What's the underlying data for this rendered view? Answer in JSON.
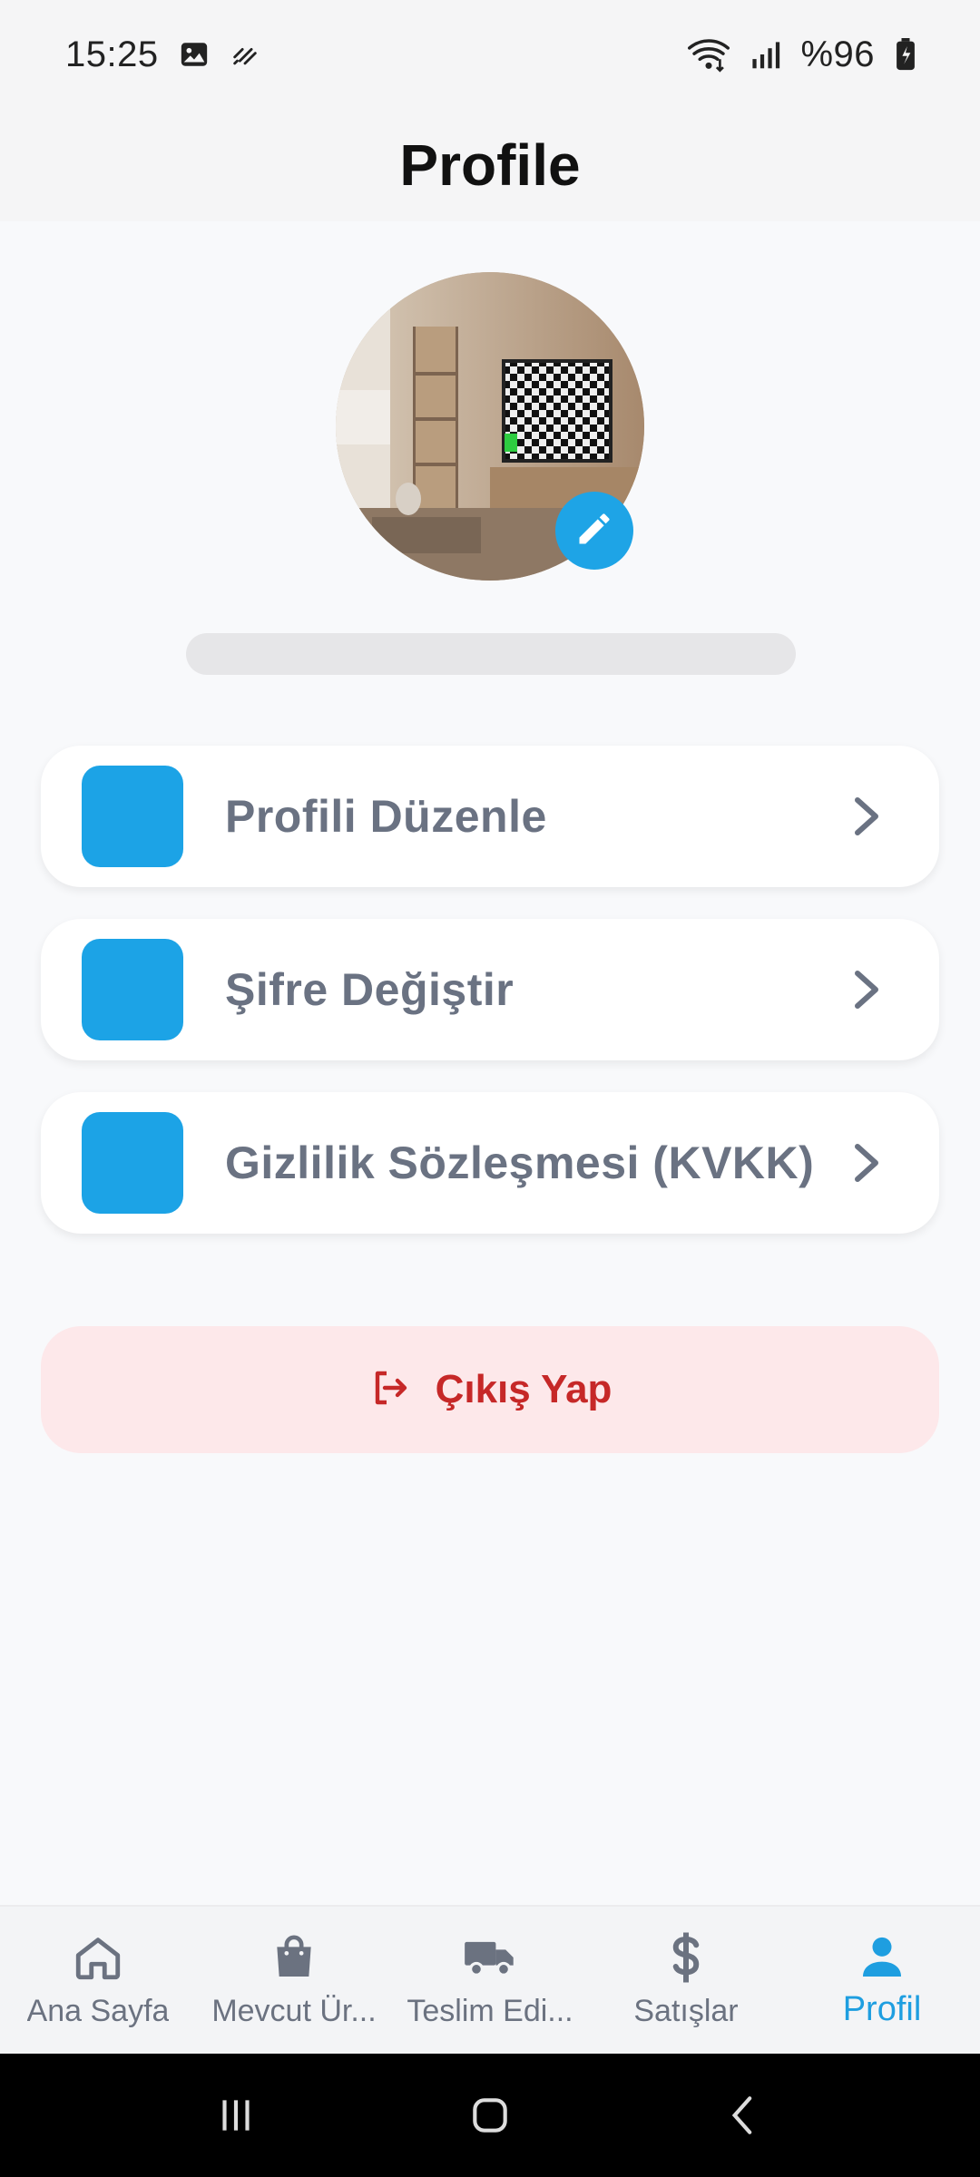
{
  "status_bar": {
    "time": "15:25",
    "battery": "%96",
    "icons": [
      "image-icon",
      "nfc-icon",
      "wifi-icon",
      "signal-icon",
      "battery-charging-icon"
    ]
  },
  "app_bar": {
    "title": "Profile"
  },
  "profile": {
    "avatar_alt": "",
    "username": ""
  },
  "menu": {
    "items": [
      {
        "label": "Profili Düzenle",
        "icon_color": "#1ca3e6"
      },
      {
        "label": "Şifre Değiştir",
        "icon_color": "#1ca3e6"
      },
      {
        "label": "Gizlilik Sözleşmesi (KVKK)",
        "icon_color": "#1ca3e6"
      }
    ]
  },
  "logout": {
    "label": "Çıkış Yap",
    "color": "#c62828",
    "background": "#fde8ea"
  },
  "bottom_nav": {
    "items": [
      {
        "label": "Ana Sayfa",
        "icon": "home-icon"
      },
      {
        "label": "Mevcut Ür...",
        "icon": "shopping-bag-icon"
      },
      {
        "label": "Teslim Edi...",
        "icon": "truck-icon"
      },
      {
        "label": "Satışlar",
        "icon": "dollar-icon"
      },
      {
        "label": "Profil",
        "icon": "person-icon",
        "active": true
      }
    ],
    "active_color": "#1e9ee0",
    "inactive_color": "#6b7280"
  },
  "accent_color": "#1ea4e6"
}
